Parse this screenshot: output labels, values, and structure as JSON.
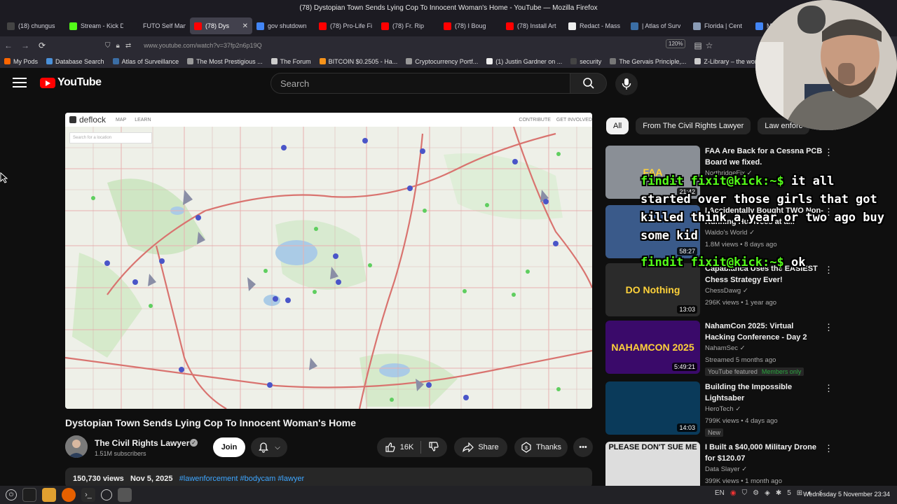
{
  "window_title": "(78) Dystopian Town Sends Lying Cop To Innocent Woman's Home - YouTube — Mozilla Firefox",
  "tabs": [
    {
      "label": "(18) chungus",
      "color": "#444444"
    },
    {
      "label": "Stream - Kick D",
      "color": "#53fc18"
    },
    {
      "label": "FUTO Self Manag",
      "color": "#1c1b22"
    },
    {
      "label": "(78) Dys",
      "color": "#ff0000",
      "active": true
    },
    {
      "label": "gov shutdown",
      "color": "#4285f4"
    },
    {
      "label": "(78) Pro-Life Fi",
      "color": "#ff0000"
    },
    {
      "label": "(78) Fr. Rip",
      "color": "#ff0000"
    },
    {
      "label": "(78) I Boug",
      "color": "#ff0000"
    },
    {
      "label": "(78) Install Art",
      "color": "#ff0000"
    },
    {
      "label": "Redact - Mass",
      "color": "#eeeeee"
    },
    {
      "label": "| Atlas of Surv",
      "color": "#3b6ea5"
    },
    {
      "label": "Florida | Cent",
      "color": "#8a9bb5"
    },
    {
      "label": "Mo",
      "color": "#4285f4"
    }
  ],
  "url": "www.youtube.com/watch?v=37fp2n6p19Q",
  "zoom": "120%",
  "bookmarks": [
    {
      "label": "My Pods",
      "color": "#ff6600"
    },
    {
      "label": "Database Search",
      "color": "#4a90d9"
    },
    {
      "label": "Atlas of Surveillance",
      "color": "#3b6ea5"
    },
    {
      "label": "The Most Prestigious ...",
      "color": "#999999"
    },
    {
      "label": "The Forum",
      "color": "#cccccc"
    },
    {
      "label": "BITCOIN $0.2505 - Ha...",
      "color": "#f7931a"
    },
    {
      "label": "Cryptocurrency Portf...",
      "color": "#999999"
    },
    {
      "label": "(1) Justin Gardner on ...",
      "color": "#eeeeee"
    },
    {
      "label": "security",
      "color": "#444444"
    },
    {
      "label": "The Gervais Principle,...",
      "color": "#777777"
    },
    {
      "label": "Z-Library – the world'...",
      "color": "#cccccc"
    }
  ],
  "youtube": {
    "logo": "YouTube",
    "search_placeholder": "Search"
  },
  "video_overlay": {
    "brand": "deflock",
    "nav_map": "MAP",
    "nav_learn": "LEARN",
    "nav_contribute": "CONTRIBUTE",
    "nav_involved": "GET INVOLVED",
    "map_search": "Search for a location"
  },
  "video": {
    "title": "Dystopian Town Sends Lying Cop To Innocent Woman's Home",
    "channel": "The Civil Rights Lawyer",
    "subscribers": "1.51M subscribers",
    "join": "Join",
    "likes": "16K",
    "share": "Share",
    "thanks": "Thanks",
    "views": "150,730 views",
    "date": "Nov 5, 2025",
    "tags": "#lawenforcement #bodycam #lawyer"
  },
  "chips": [
    "All",
    "From The Civil Rights Lawyer",
    "Law enforc"
  ],
  "recommendations": [
    {
      "title": "FAA Are Back for a Cessna PCB Board we fixed.",
      "channel": "NorthridgeFix",
      "meta": "",
      "duration": "21:42",
      "thumb_text": "FAA",
      "thumb_color": "#8a8f96"
    },
    {
      "title": "I Accidentally Bought TWO Non-Running Humvees at a...",
      "channel": "Waldo's World",
      "meta": "1.8M views • 8 days ago",
      "duration": "58:27",
      "thumb_text": "",
      "thumb_color": "#3a5a8a"
    },
    {
      "title": "Capablanca Uses the EASIEST Chess Strategy Ever!",
      "channel": "ChessDawg",
      "meta": "296K views • 1 year ago",
      "duration": "13:03",
      "thumb_text": "DO Nothing",
      "thumb_color": "#2b2b2b"
    },
    {
      "title": "NahamCon 2025: Virtual Hacking Conference - Day 2",
      "channel": "NahamSec",
      "meta": "Streamed 5 months ago",
      "duration": "5:49:21",
      "thumb_text": "NAHAMCON 2025",
      "thumb_color": "#3a0a6a",
      "badges": [
        "YouTube featured",
        "Members only"
      ]
    },
    {
      "title": "Building the Impossible Lightsaber",
      "channel": "HeroTech",
      "meta": "799K views • 4 days ago",
      "duration": "14:03",
      "thumb_text": "",
      "thumb_color": "#0a3a5a",
      "badges": [
        "New"
      ]
    },
    {
      "title": "I Built a $40,000 Military Drone for $120.07",
      "channel": "Data Slayer",
      "meta": "399K views • 1 month ago",
      "duration": "",
      "thumb_text": "PLEASE DON'T SUE ME",
      "thumb_color": "#dddddd"
    }
  ],
  "chat": [
    {
      "user": "findit fixit@kick:~$",
      "message": "it all started over those girls that got killed think a year or two ago buy some kid"
    },
    {
      "user": "findit fixit@kick:~$",
      "message": "ok"
    }
  ],
  "taskbar": {
    "language": "EN",
    "volume_level": "5",
    "clock": "Wednesday  5 November 23:34"
  }
}
